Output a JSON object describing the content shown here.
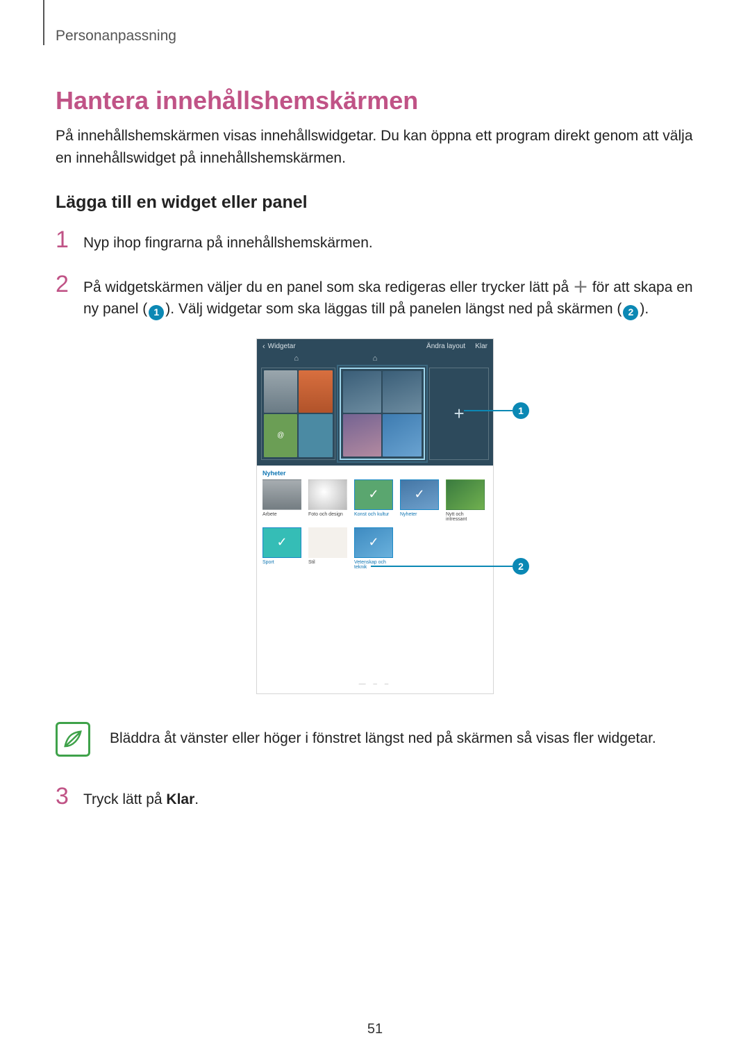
{
  "breadcrumb": "Personanpassning",
  "title": "Hantera innehållshemskärmen",
  "intro": "På innehållshemskärmen visas innehållswidgetar. Du kan öppna ett program direkt genom att välja en innehållswidget på innehållshemskärmen.",
  "subheading": "Lägga till en widget eller panel",
  "steps": {
    "s1": {
      "num": "1",
      "text": "Nyp ihop fingrarna på innehållshemskärmen."
    },
    "s2": {
      "num": "2",
      "pre": "På widgetskärmen väljer du en panel som ska redigeras eller trycker lätt på ",
      "mid1": " för att skapa en ny panel (",
      "mid2": "). Välj widgetar som ska läggas till på panelen längst ned på skärmen (",
      "post": ").",
      "badge1": "1",
      "badge2": "2"
    },
    "s3": {
      "num": "3",
      "pre": "Tryck lätt på ",
      "bold": "Klar",
      "post": "."
    }
  },
  "note": "Bläddra åt vänster eller höger i fönstret längst ned på skärmen så visas fler widgetar.",
  "pageNumber": "51",
  "callouts": {
    "one": "1",
    "two": "2"
  },
  "device": {
    "header": {
      "title": "Widgetar",
      "action1": "Ändra layout",
      "action2": "Klar"
    },
    "category": "Nyheter",
    "widgets": [
      {
        "label": "Arbete",
        "blue": false,
        "selected": false,
        "thumb": "th1"
      },
      {
        "label": "Foto och design",
        "blue": false,
        "selected": false,
        "thumb": "th2"
      },
      {
        "label": "Konst och kultur",
        "blue": true,
        "selected": true,
        "thumb": "th3"
      },
      {
        "label": "Nyheter",
        "blue": true,
        "selected": true,
        "thumb": "th4"
      },
      {
        "label": "Nytt och intressant",
        "blue": false,
        "selected": false,
        "thumb": "th5"
      },
      {
        "label": "Sport",
        "blue": true,
        "selected": true,
        "thumb": "th6"
      },
      {
        "label": "Stil",
        "blue": false,
        "selected": false,
        "thumb": "th7"
      },
      {
        "label": "Vetenskap och teknik",
        "blue": true,
        "selected": true,
        "thumb": "th8"
      }
    ]
  }
}
